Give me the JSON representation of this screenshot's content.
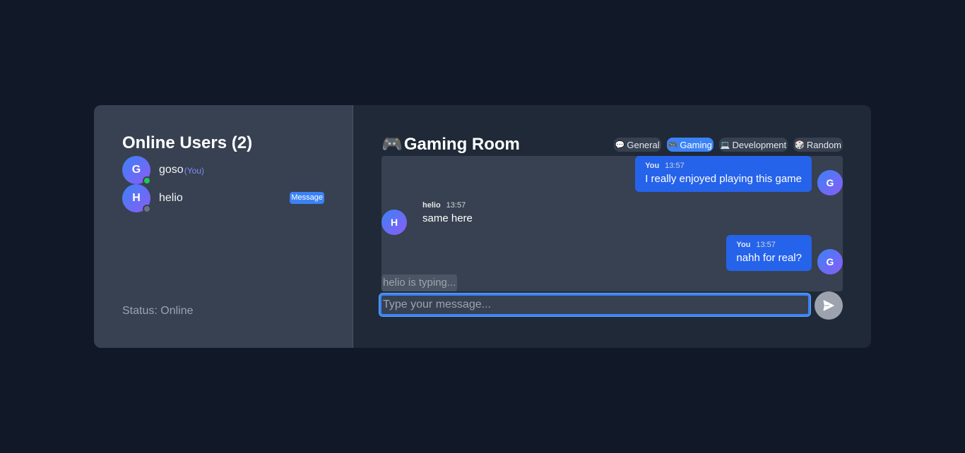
{
  "sidebar": {
    "title": "Online Users (2)",
    "users": [
      {
        "initial": "G",
        "name": "goso",
        "tag": "(You)",
        "presence": "online"
      },
      {
        "initial": "H",
        "name": "helio",
        "action": "Message",
        "presence": "offline"
      }
    ],
    "status": "Status: Online"
  },
  "room": {
    "icon": "🎮",
    "title": "Gaming Room",
    "tabs": [
      {
        "icon": "💬",
        "label": "General",
        "active": false
      },
      {
        "icon": "🎮",
        "label": "Gaming",
        "active": true
      },
      {
        "icon": "💻",
        "label": "Development",
        "active": false
      },
      {
        "icon": "🎲",
        "label": "Random",
        "active": false
      }
    ]
  },
  "messages": [
    {
      "sender": "You",
      "time": "13:57",
      "text": "I really enjoyed playing this game",
      "initial": "G",
      "mine": true
    },
    {
      "sender": "helio",
      "time": "13:57",
      "text": "same here",
      "initial": "H",
      "mine": false
    },
    {
      "sender": "You",
      "time": "13:57",
      "text": "nahh for real?",
      "initial": "G",
      "mine": true
    }
  ],
  "typing_indicator": "helio is typing...",
  "composer": {
    "placeholder": "Type your message..."
  },
  "icons": {
    "send": "send-icon"
  },
  "colors": {
    "accent": "#3b82f6",
    "bubble": "#2563eb",
    "online": "#22c55e",
    "background": "#111827"
  }
}
